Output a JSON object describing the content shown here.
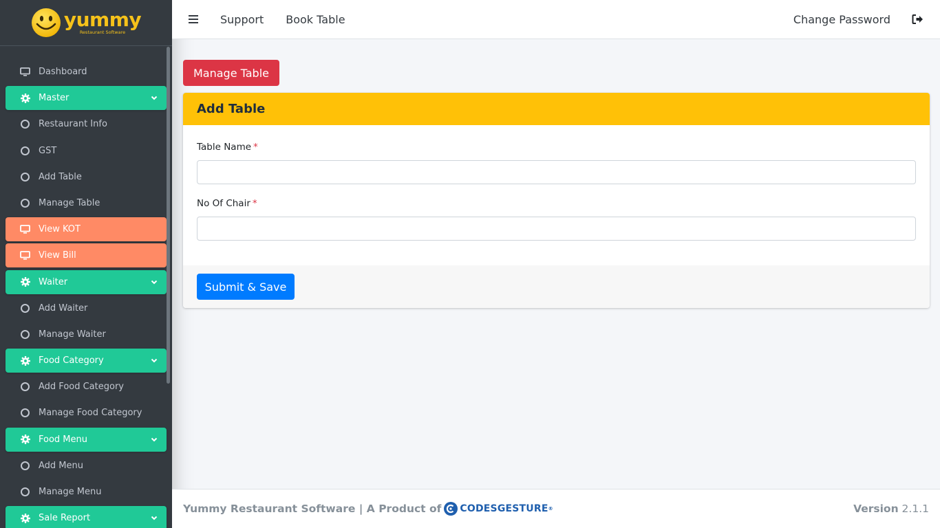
{
  "brand": {
    "logo_text": "yummy",
    "logo_sub": "Restaurant Software"
  },
  "sidebar": {
    "items": [
      {
        "label": "Dashboard",
        "icon": "monitor-icon",
        "style": "plain"
      },
      {
        "label": "Master",
        "icon": "gear-icon",
        "style": "green",
        "expandable": true
      },
      {
        "label": "Restaurant Info",
        "icon": "circle-icon",
        "style": "plain"
      },
      {
        "label": "GST",
        "icon": "circle-icon",
        "style": "plain"
      },
      {
        "label": "Add Table",
        "icon": "circle-icon",
        "style": "plain"
      },
      {
        "label": "Manage Table",
        "icon": "circle-icon",
        "style": "plain"
      },
      {
        "label": "View KOT",
        "icon": "monitor-icon",
        "style": "orange"
      },
      {
        "label": "View Bill",
        "icon": "monitor-icon",
        "style": "orange"
      },
      {
        "label": "Waiter",
        "icon": "gear-icon",
        "style": "green",
        "expandable": true
      },
      {
        "label": "Add Waiter",
        "icon": "circle-icon",
        "style": "plain"
      },
      {
        "label": "Manage Waiter",
        "icon": "circle-icon",
        "style": "plain"
      },
      {
        "label": "Food Category",
        "icon": "gear-icon",
        "style": "green",
        "expandable": true
      },
      {
        "label": "Add Food Category",
        "icon": "circle-icon",
        "style": "plain"
      },
      {
        "label": "Manage Food Category",
        "icon": "circle-icon",
        "style": "plain"
      },
      {
        "label": "Food Menu",
        "icon": "gear-icon",
        "style": "green",
        "expandable": true
      },
      {
        "label": "Add Menu",
        "icon": "circle-icon",
        "style": "plain"
      },
      {
        "label": "Manage Menu",
        "icon": "circle-icon",
        "style": "plain"
      },
      {
        "label": "Sale Report",
        "icon": "gear-icon",
        "style": "green",
        "expandable": true
      }
    ]
  },
  "topbar": {
    "support": "Support",
    "book_table": "Book Table",
    "change_password": "Change Password"
  },
  "main": {
    "manage_button": "Manage Table",
    "card_title": "Add Table",
    "fields": [
      {
        "label": "Table Name",
        "required": "*",
        "value": ""
      },
      {
        "label": "No Of Chair",
        "required": "*",
        "value": ""
      }
    ],
    "submit_button": "Submit & Save"
  },
  "footer": {
    "left_text": "Yummy Restaurant Software | A Product of",
    "company": "CODESGESTURE",
    "reg": "®",
    "version_label": "Version",
    "version": "2.1.1"
  },
  "colors": {
    "sidebar_bg": "#343a40",
    "green": "#20c997",
    "orange": "#ff8a65",
    "danger": "#dc3545",
    "warning": "#ffc107",
    "primary": "#007bff"
  }
}
